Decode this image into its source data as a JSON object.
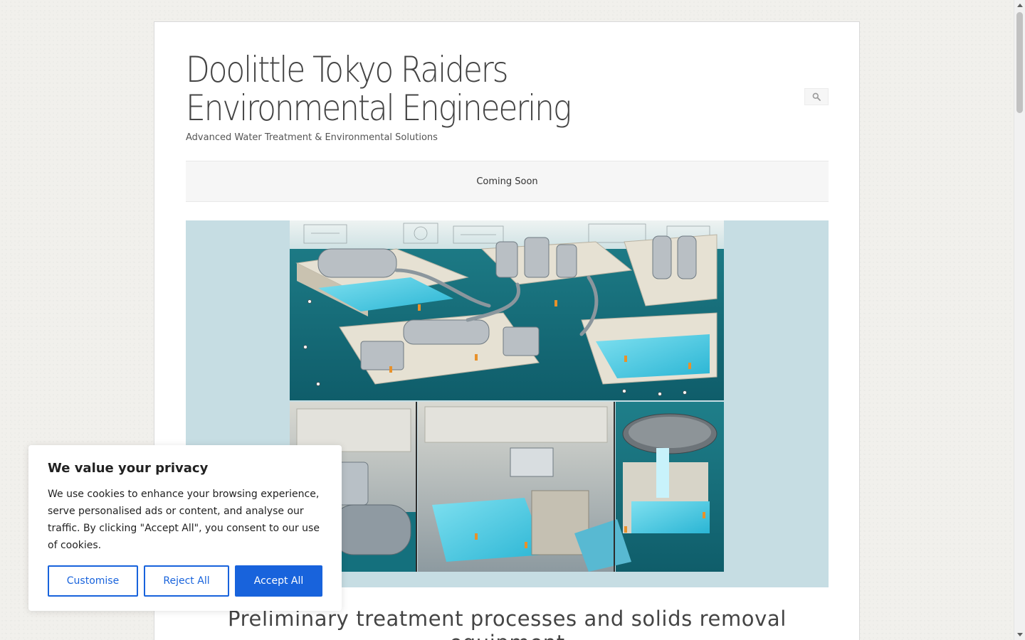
{
  "site": {
    "title": "Doolittle Tokyo Raiders Environmental Engineering",
    "tagline": "Advanced Water Treatment & Environmental Solutions"
  },
  "search": {
    "icon": "search-icon"
  },
  "nav": {
    "items": [
      "Coming Soon"
    ]
  },
  "post": {
    "title": "Preliminary treatment processes and solids removal equipment"
  },
  "cookie": {
    "title": "We value your privacy",
    "text": "We use cookies to enhance your browsing experience, serve personalised ads or content, and analyse our traffic. By clicking \"Accept All\", you consent to our use of cookies.",
    "customise_label": "Customise",
    "reject_label": "Reject All",
    "accept_label": "Accept All",
    "accent_color": "#1863dc"
  }
}
